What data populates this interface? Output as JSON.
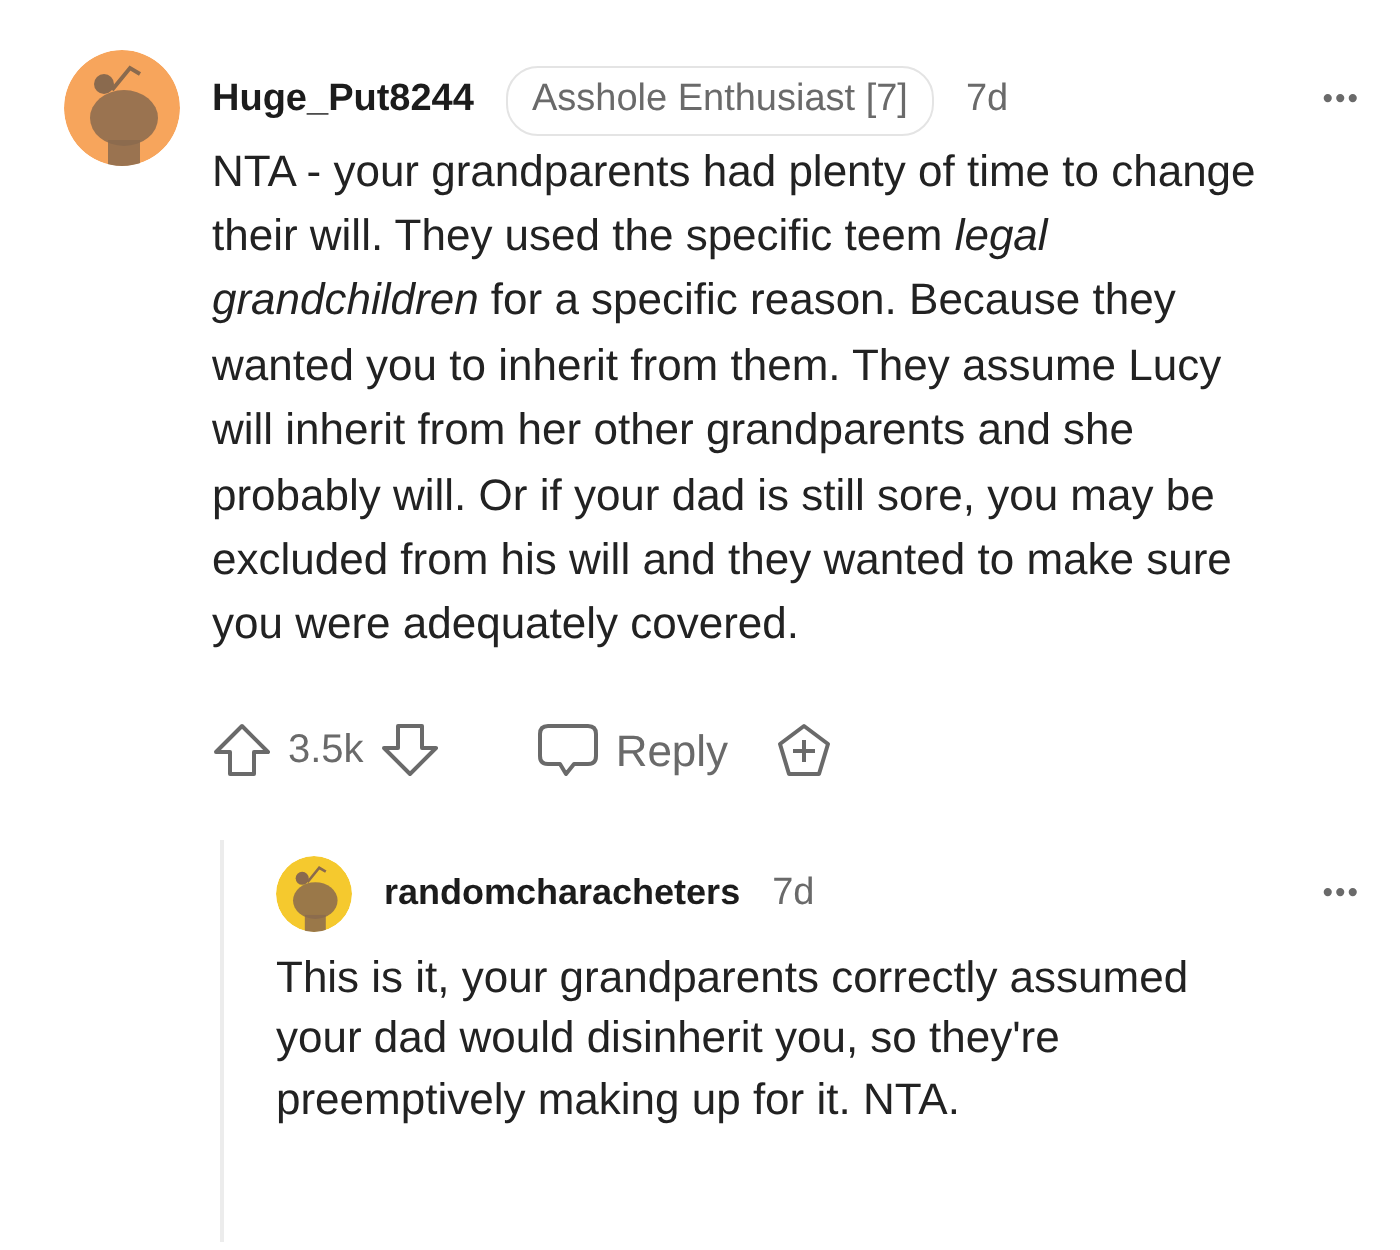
{
  "comment": {
    "username": "Huge_Put8244",
    "flair": "Asshole Enthusiast [7]",
    "age": "7d",
    "more": "•••",
    "body": "NTA - your grandparents had plenty of time to change their will. They used the specific teem *legal grandchildren* for a specific reason. Because they wanted you to inherit from them. They assume Lucy will inherit from her other grandparents and she probably will. Or if your dad is still sore, you may be excluded from his will and they wanted to make sure you were adequately covered.",
    "score": "3.5k",
    "reply_label": "Reply"
  },
  "reply": {
    "username": "randomcharacheters",
    "age": "7d",
    "more": "•••",
    "body": "This is it, your grandparents correctly assumed your dad would disinherit you, so they're preemptively making up for it. NTA."
  }
}
